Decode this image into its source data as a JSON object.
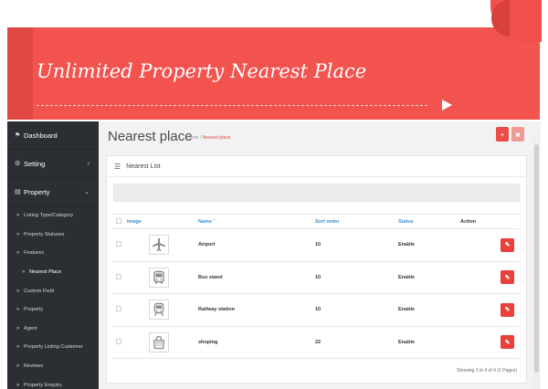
{
  "banner": {
    "title": "Unlimited Property Nearest Place"
  },
  "sidebar": {
    "main": [
      {
        "label": "Dashboard",
        "icon": "dashboard-icon"
      },
      {
        "label": "Setting",
        "icon": "cogs-icon"
      },
      {
        "label": "Property",
        "icon": "document-icon"
      }
    ],
    "sub": [
      {
        "label": "Listing Type/Category"
      },
      {
        "label": "Property Statuses"
      },
      {
        "label": "Features"
      },
      {
        "label": "Nearest Place"
      },
      {
        "label": "Custom Field"
      },
      {
        "label": "Property"
      },
      {
        "label": "Agent"
      },
      {
        "label": "Property Listing Customer"
      },
      {
        "label": "Reviews"
      },
      {
        "label": "Property Enquiry"
      }
    ]
  },
  "page": {
    "title": "Nearest place",
    "breadcrumb_home": "Home",
    "breadcrumb_sep": "/",
    "breadcrumb_current": "Nearest place"
  },
  "panel": {
    "title": "Nearest List",
    "columns": {
      "image": "Image",
      "name": "Name",
      "sort": "Sort order",
      "status": "Status",
      "action": "Action"
    },
    "rows": [
      {
        "name": "Airport",
        "sort": "10",
        "status": "Enable",
        "icon": "airplane-icon"
      },
      {
        "name": "Bus stand",
        "sort": "10",
        "status": "Enable",
        "icon": "bus-icon"
      },
      {
        "name": "Railway station",
        "sort": "10",
        "status": "Enable",
        "icon": "train-icon"
      },
      {
        "name": "shoping",
        "sort": "22",
        "status": "Enable",
        "icon": "shopping-bag-icon"
      }
    ],
    "pager": "Showing 1 to 4 of 4 (1 Pages)"
  },
  "colors": {
    "accent": "#ea4b47",
    "sidebar": "#2b2f33",
    "link": "#3a8fd0"
  }
}
